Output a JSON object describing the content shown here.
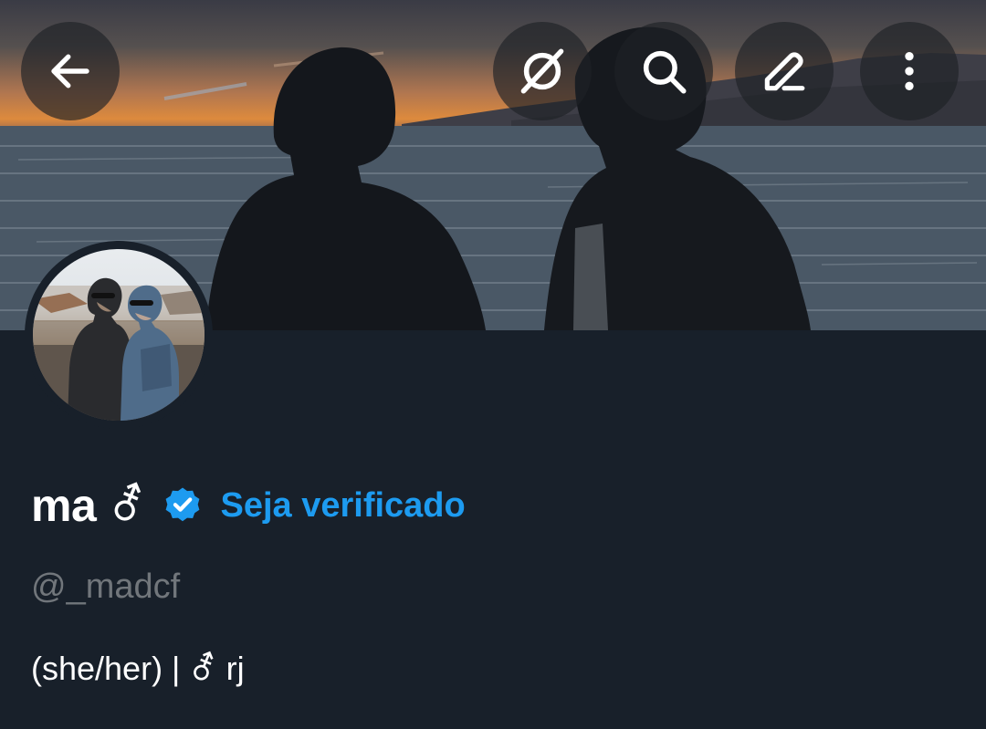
{
  "header": {
    "back_icon": "arrow-left-icon",
    "grok_icon": "grok-icon",
    "search_icon": "search-icon",
    "edit_icon": "edit-pencil-icon",
    "more_icon": "more-vertical-icon"
  },
  "profile": {
    "display_name": "ma",
    "name_symbol": "⚦",
    "verify_label": "Seja verificado",
    "handle": "@_madcf",
    "bio": "(she/her) | ⚦ rj"
  },
  "colors": {
    "background": "#15202b",
    "accent": "#1d9bf0",
    "secondary_text": "#71767b"
  }
}
